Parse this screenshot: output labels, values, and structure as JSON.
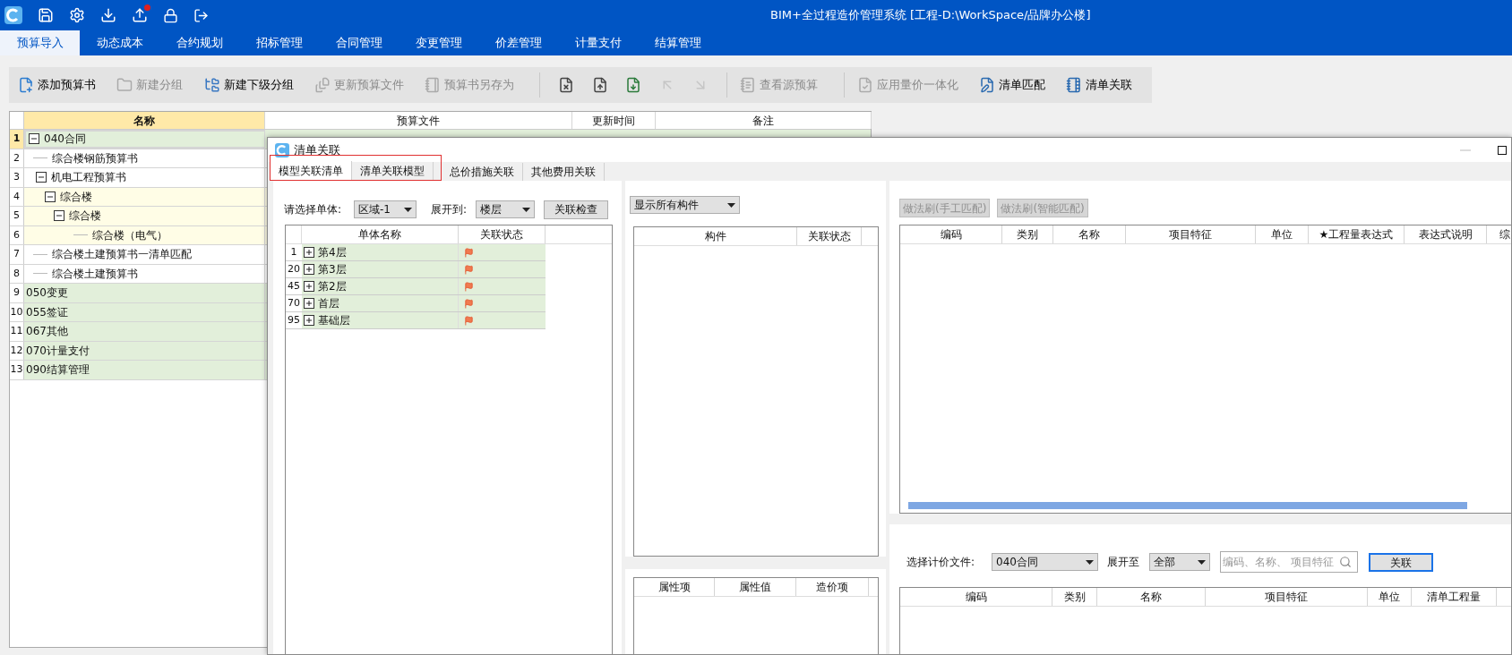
{
  "title_bar": {
    "title": "BIM+全过程造价管理系统 [工程-D:\\WorkSpace/品牌办公楼]"
  },
  "menu_tabs": [
    {
      "label": "预算导入",
      "selected": true
    },
    {
      "label": "动态成本",
      "selected": false
    },
    {
      "label": "合约规划",
      "selected": false
    },
    {
      "label": "招标管理",
      "selected": false
    },
    {
      "label": "合同管理",
      "selected": false
    },
    {
      "label": "变更管理",
      "selected": false
    },
    {
      "label": "价差管理",
      "selected": false
    },
    {
      "label": "计量支付",
      "selected": false
    },
    {
      "label": "结算管理",
      "selected": false
    }
  ],
  "toolbar": [
    {
      "kind": "button",
      "label": "添加预算书",
      "disabled": false
    },
    {
      "kind": "button",
      "label": "新建分组",
      "disabled": true
    },
    {
      "kind": "button",
      "label": "新建下级分组",
      "disabled": false
    },
    {
      "kind": "button",
      "label": "更新预算文件",
      "disabled": true
    },
    {
      "kind": "button",
      "label": "预算书另存为",
      "disabled": true
    },
    {
      "kind": "separator"
    },
    {
      "kind": "icon_button",
      "disabled": false
    },
    {
      "kind": "icon_button",
      "disabled": false
    },
    {
      "kind": "icon_button",
      "disabled": false
    },
    {
      "kind": "icon_button",
      "disabled": true
    },
    {
      "kind": "icon_button",
      "disabled": true
    },
    {
      "kind": "separator"
    },
    {
      "kind": "button",
      "label": "查看源预算",
      "disabled": true
    },
    {
      "kind": "separator"
    },
    {
      "kind": "button",
      "label": "应用量价一体化",
      "disabled": true
    },
    {
      "kind": "button",
      "label": "清单匹配",
      "disabled": false
    },
    {
      "kind": "button",
      "label": "清单关联",
      "disabled": false
    }
  ],
  "tree": {
    "columns": [
      "名称",
      "预算文件",
      "更新时间",
      "备注"
    ],
    "rows": [
      {
        "number": "1",
        "label": "040合同",
        "kind": "group",
        "selected": true,
        "expanded": true,
        "children": [
          {
            "number": "2",
            "label": "综合楼钢筋预算书",
            "kind": "book",
            "selected": false
          },
          {
            "number": "3",
            "label": "机电工程预算书",
            "kind": "book",
            "selected": false,
            "expanded": true,
            "children": [
              {
                "number": "4",
                "label": "综合楼",
                "kind": "unit",
                "selected": false,
                "expanded": true,
                "children": [
                  {
                    "number": "5",
                    "label": "综合楼",
                    "kind": "unit",
                    "selected": false,
                    "expanded": true,
                    "children": [
                      {
                        "number": "6",
                        "label": "综合楼（电气）",
                        "kind": "unit",
                        "selected": false
                      }
                    ]
                  }
                ]
              }
            ]
          },
          {
            "number": "7",
            "label": "综合楼土建预算书一清单匹配",
            "kind": "book",
            "selected": false
          },
          {
            "number": "8",
            "label": "综合楼土建预算书",
            "kind": "book",
            "selected": false
          }
        ]
      },
      {
        "number": "9",
        "label": "050变更",
        "kind": "group",
        "selected": false
      },
      {
        "number": "10",
        "label": "055签证",
        "kind": "group",
        "selected": false
      },
      {
        "number": "11",
        "label": "067其他",
        "kind": "group",
        "selected": false
      },
      {
        "number": "12",
        "label": "070计量支付",
        "kind": "group",
        "selected": false
      },
      {
        "number": "13",
        "label": "090结算管理",
        "kind": "group",
        "selected": false
      }
    ]
  },
  "dialog": {
    "title": "清单关联",
    "tabs": [
      {
        "label": "模型关联清单",
        "selected": true
      },
      {
        "label": "清单关联模型",
        "selected": false
      },
      {
        "label": "总价措施关联",
        "selected": false
      },
      {
        "label": "其他费用关联",
        "selected": false
      }
    ],
    "unit_panel": {
      "unit_label": "请选择单体:",
      "unit_value": "区域-1",
      "expand_label": "展开到:",
      "expand_value": "楼层",
      "check_button": "关联检查",
      "columns": [
        "单体名称",
        "关联状态"
      ],
      "rows": [
        {
          "number": "1",
          "label": "第4层",
          "expanded": false,
          "flagged": true
        },
        {
          "number": "20",
          "label": "第3层",
          "expanded": false,
          "flagged": true
        },
        {
          "number": "45",
          "label": "第2层",
          "expanded": false,
          "flagged": true
        },
        {
          "number": "70",
          "label": "首层",
          "expanded": false,
          "flagged": true
        },
        {
          "number": "95",
          "label": "基础层",
          "expanded": false,
          "flagged": true
        }
      ]
    },
    "component_panel": {
      "filter_value": "显示所有构件",
      "columns": [
        "构件",
        "关联状态"
      ],
      "property_columns": [
        "属性项",
        "属性值",
        "造价项"
      ]
    },
    "bill_panel": {
      "buttons": [
        {
          "label": "做法刷(手工匹配)",
          "disabled": true
        },
        {
          "label": "做法刷(智能匹配)",
          "disabled": true
        }
      ],
      "columns": [
        "编码",
        "类别",
        "名称",
        "项目特征",
        "单位",
        "★工程量表达式",
        "表达式说明",
        "综"
      ],
      "file_label": "选择计价文件:",
      "file_value": "040合同",
      "expand_label": "展开至",
      "expand_value": "全部",
      "search_placeholder": "编码、名称、 项目特征",
      "link_button": "关联",
      "bottom_columns": [
        "编码",
        "类别",
        "名称",
        "项目特征",
        "单位",
        "清单工程量"
      ]
    }
  }
}
